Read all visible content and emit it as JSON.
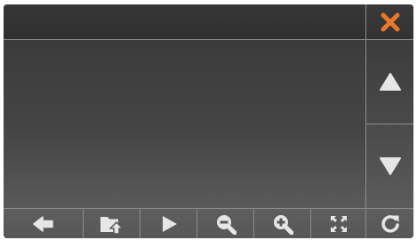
{
  "colors": {
    "close_accent": "#e8782a",
    "icon": "#e6e6e6",
    "panel_dark": "#333333",
    "panel_light": "#5a5a5a",
    "divider": "#8c8c8c"
  },
  "window": {
    "close_icon": "close-icon"
  },
  "side_controls": [
    {
      "id": "scroll-up",
      "icon": "triangle-up-icon"
    },
    {
      "id": "scroll-down",
      "icon": "triangle-down-icon"
    }
  ],
  "toolbar": {
    "buttons": [
      {
        "id": "back",
        "icon": "arrow-left-icon"
      },
      {
        "id": "open-folder",
        "icon": "folder-upload-icon"
      },
      {
        "id": "play",
        "icon": "play-icon"
      },
      {
        "id": "zoom-out",
        "icon": "zoom-out-icon"
      },
      {
        "id": "zoom-in",
        "icon": "zoom-in-icon"
      },
      {
        "id": "fullscreen",
        "icon": "fullscreen-icon"
      },
      {
        "id": "refresh",
        "icon": "refresh-icon"
      }
    ]
  }
}
